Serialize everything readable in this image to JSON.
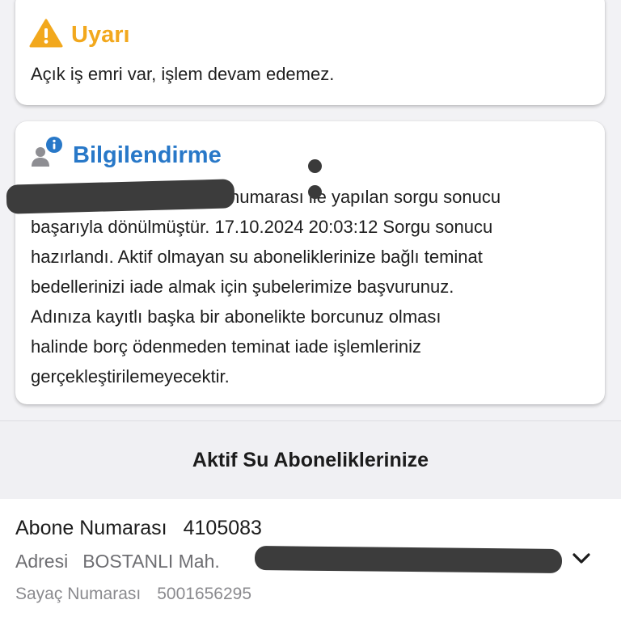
{
  "warning": {
    "title": "Uyarı",
    "message": "Açık iş emri var, işlem devam edemez.",
    "icon": "warning-triangle-icon",
    "color": "#f2a81d"
  },
  "info": {
    "title": "Bilgilendirme",
    "icon": "user-info-icon",
    "color": "#2878c8",
    "line1_suffix": "numarası ile yapılan sorgu sonucu",
    "line2": "başarıyla dönülmüştür. 17.10.2024 20:03:12 Sorgu sonucu",
    "line3": "hazırlandı. Aktif olmayan su aboneliklerinize bağlı teminat",
    "line4": "bedellerinizi iade almak için şubelerimize başvurunuz.",
    "line5": "Adınıza kayıtlı başka bir abonelikte borcunuz olması",
    "line6": "halinde borç ödenmeden teminat iade işlemleriniz",
    "line7": "gerçekleştirilemeyecektir."
  },
  "section": {
    "title": "Aktif Su Aboneliklerinize"
  },
  "subscription": {
    "abone_label": "Abone Numarası",
    "abone_value": "4105083",
    "adres_label": "Adresi",
    "adres_value": "BOSTANLI Mah.",
    "sayac_label": "Sayaç Numarası",
    "sayac_value": "5001656295",
    "expand_icon": "chevron-down-icon"
  }
}
